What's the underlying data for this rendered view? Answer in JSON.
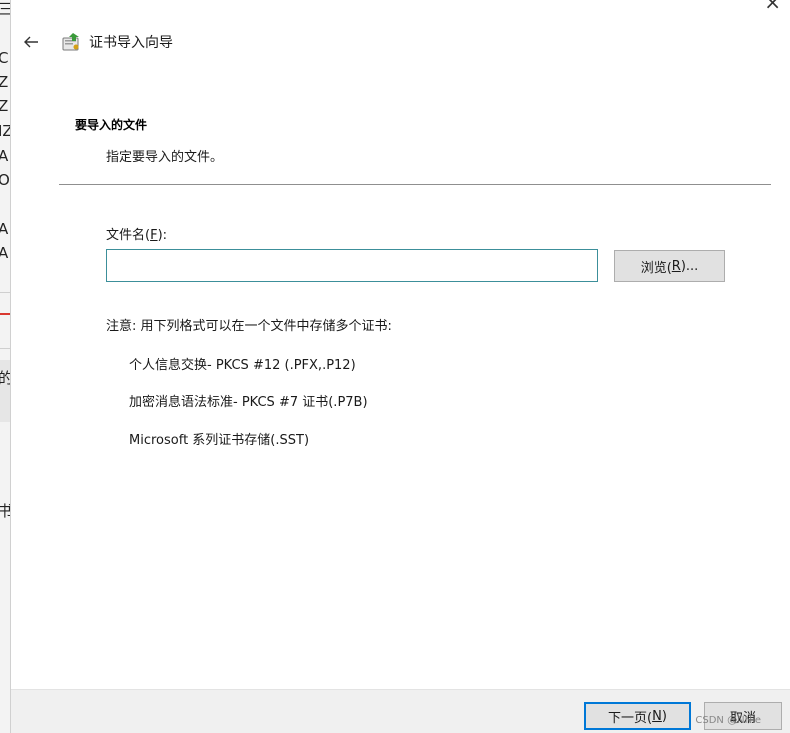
{
  "background_window": {
    "fragments": [
      "三",
      "C",
      "Z",
      "Z",
      "IZ",
      "A",
      "O",
      "A",
      "A",
      "的",
      "书"
    ]
  },
  "window": {
    "close_glyph": "×"
  },
  "wizard": {
    "title": "证书导入向导",
    "back_icon": "arrow-left-icon",
    "wizard_icon": "certificate-wizard-icon"
  },
  "section": {
    "heading": "要导入的文件",
    "subtitle": "指定要导入的文件。"
  },
  "file": {
    "label_prefix": "文件名(",
    "label_accel": "F",
    "label_suffix": "):",
    "value": "",
    "placeholder": ""
  },
  "browse": {
    "label_prefix": "浏览(",
    "label_accel": "R",
    "label_suffix": ")..."
  },
  "note": "注意: 用下列格式可以在一个文件中存储多个证书:",
  "formats": [
    "个人信息交换- PKCS #12 (.PFX,.P12)",
    "加密消息语法标准- PKCS #7 证书(.P7B)",
    "Microsoft 系列证书存储(.SST)"
  ],
  "footer": {
    "next_prefix": "下一页(",
    "next_accel": "N",
    "next_suffix": ")",
    "cancel": "取消",
    "watermark": "CSDN @NNie"
  },
  "colors": {
    "accent": "#0078d7",
    "input_border": "#3c8f9a",
    "button_bg": "#e1e1e1",
    "footer_bg": "#f0f0f0"
  }
}
